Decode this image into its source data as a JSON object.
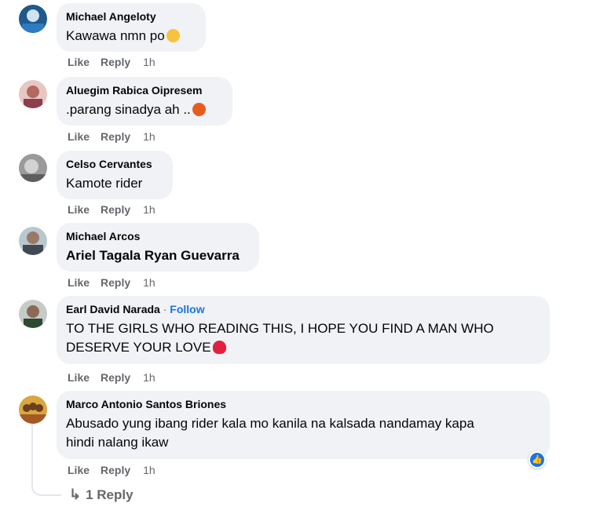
{
  "comments": [
    {
      "author": "Michael Angeloty",
      "text": "Kawawa nmn po",
      "emoji": "crying-emoji",
      "like": "Like",
      "reply": "Reply",
      "time": "1h"
    },
    {
      "author": "Aluegim Rabica Oipresem",
      "text": ".parang sinadya ah ..",
      "emoji": "angry-emoji",
      "like": "Like",
      "reply": "Reply",
      "time": "1h"
    },
    {
      "author": "Celso Cervantes",
      "text": "Kamote rider",
      "like": "Like",
      "reply": "Reply",
      "time": "1h"
    },
    {
      "author": "Michael Arcos",
      "text": "Ariel Tagala Ryan Guevarra",
      "like": "Like",
      "reply": "Reply",
      "time": "1h"
    },
    {
      "author": "Earl David Narada",
      "follow": "Follow",
      "separator": "·",
      "text_line1": "TO THE GIRLS WHO READING THIS, I HOPE YOU FIND A MAN WHO",
      "text_line2": "DESERVE YOUR LOVE",
      "emoji": "red-heart-emoji",
      "like": "Like",
      "reply": "Reply",
      "time": "1h"
    },
    {
      "author": "Marco Antonio Santos Briones",
      "text_line1": "Abusado yung ibang rider kala mo kanila na kalsada nandamay kapa",
      "text_line2": "hindi nalang ikaw",
      "reaction": "like-reaction-icon",
      "like": "Like",
      "reply": "Reply",
      "time": "1h"
    }
  ],
  "replies_link": "1 Reply",
  "colors": {
    "bubble": "#f0f2f5",
    "meta": "#65676b",
    "follow": "#1b74e4",
    "heart": "#e41e3f"
  }
}
